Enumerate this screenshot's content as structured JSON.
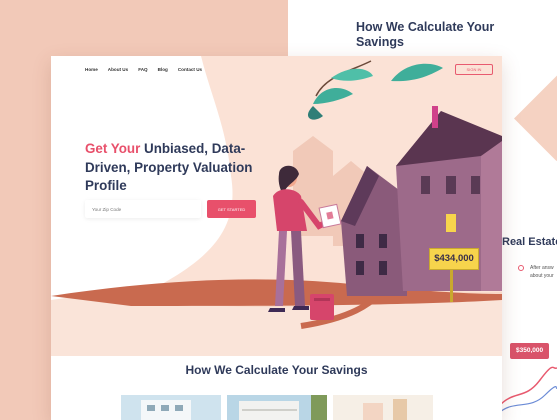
{
  "back": {
    "title": "How We Calculate Your Savings",
    "section_title": "Real Estate L",
    "bullet_text": "After answ about your",
    "price": "$350,000"
  },
  "nav": {
    "items": [
      {
        "label": "Home"
      },
      {
        "label": "About Us"
      },
      {
        "label": "FAQ"
      },
      {
        "label": "Blog"
      },
      {
        "label": "Contact Us"
      }
    ],
    "signin_label": "SIGN IN"
  },
  "hero": {
    "headline_accent": "Get Your",
    "headline_rest": " Unbiased, Data-Driven, Property Valuation Profile",
    "zip_placeholder": "Your Zip Code",
    "cta_label": "GET STARTED",
    "price_tag": "$434,000"
  },
  "section": {
    "title": "How We Calculate Your Savings"
  },
  "colors": {
    "accent": "#e8506b",
    "navy": "#2f3a5a",
    "peach": "#f2c9b8",
    "house_purple": "#8a5a7a",
    "yellow": "#f7d44c"
  }
}
